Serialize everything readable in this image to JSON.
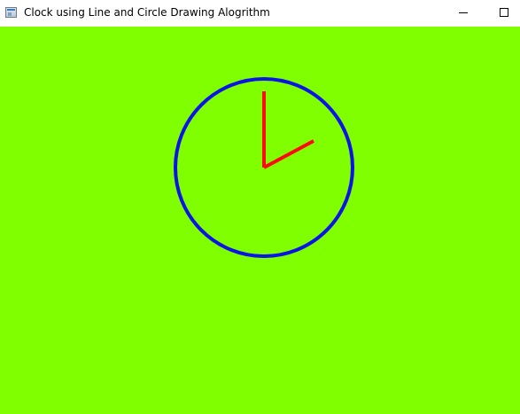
{
  "window": {
    "title": "Clock using Line and Circle Drawing Alogrithm",
    "icons": {
      "app": "application-icon",
      "minimize": "minimize-icon",
      "maximize": "maximize-icon"
    }
  },
  "canvas": {
    "background_color": "#80ff00",
    "clock_face": {
      "shape": "circle",
      "stroke_color": "#0a14e6"
    },
    "hands": [
      {
        "name": "hour-hand",
        "color": "#ff0a0a",
        "points_to": "12"
      },
      {
        "name": "minute-hand",
        "color": "#ff0a0a",
        "points_to": "2"
      }
    ]
  }
}
